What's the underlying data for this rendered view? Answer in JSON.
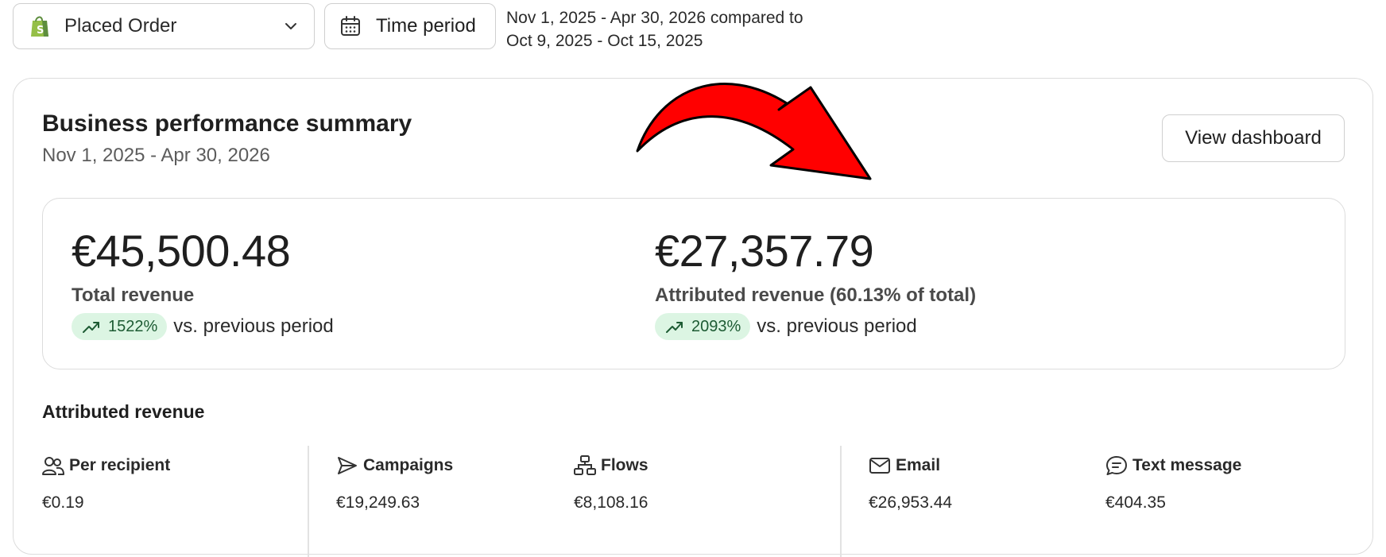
{
  "filters": {
    "metric_dropdown": {
      "label": "Placed Order",
      "icon": "shopify-bag-icon"
    },
    "time_period_button": {
      "label": "Time period",
      "icon": "calendar-icon"
    },
    "range_line1": "Nov 1, 2025 - Apr 30, 2026 compared to",
    "range_line2": "Oct 9, 2025 - Oct 15, 2025"
  },
  "summary_card": {
    "title": "Business performance summary",
    "date_range": "Nov 1, 2025 - Apr 30, 2026",
    "view_dashboard_label": "View dashboard",
    "total": {
      "amount": "€45,500.48",
      "label": "Total revenue",
      "change": "1522%",
      "comparison": "vs. previous period"
    },
    "attributed": {
      "amount": "€27,357.79",
      "label": "Attributed revenue (60.13% of total)",
      "change": "2093%",
      "comparison": "vs. previous period"
    }
  },
  "attributed_section": {
    "title": "Attributed revenue",
    "columns": [
      {
        "icon": "users-icon",
        "label": "Per recipient",
        "value": "€0.19"
      },
      {
        "icon": "send-icon",
        "label": "Campaigns",
        "value": "€19,249.63"
      },
      {
        "icon": "flows-icon",
        "label": "Flows",
        "value": "€8,108.16"
      },
      {
        "icon": "email-icon",
        "label": "Email",
        "value": "€26,953.44"
      },
      {
        "icon": "text-message-icon",
        "label": "Text message",
        "value": "€404.35"
      }
    ]
  },
  "colors": {
    "positive_pill_bg": "#dcf5e3",
    "positive_pill_text": "#1d5b33",
    "annotation_arrow": "#ff0000",
    "shopify_green": "#5e8e3e"
  }
}
